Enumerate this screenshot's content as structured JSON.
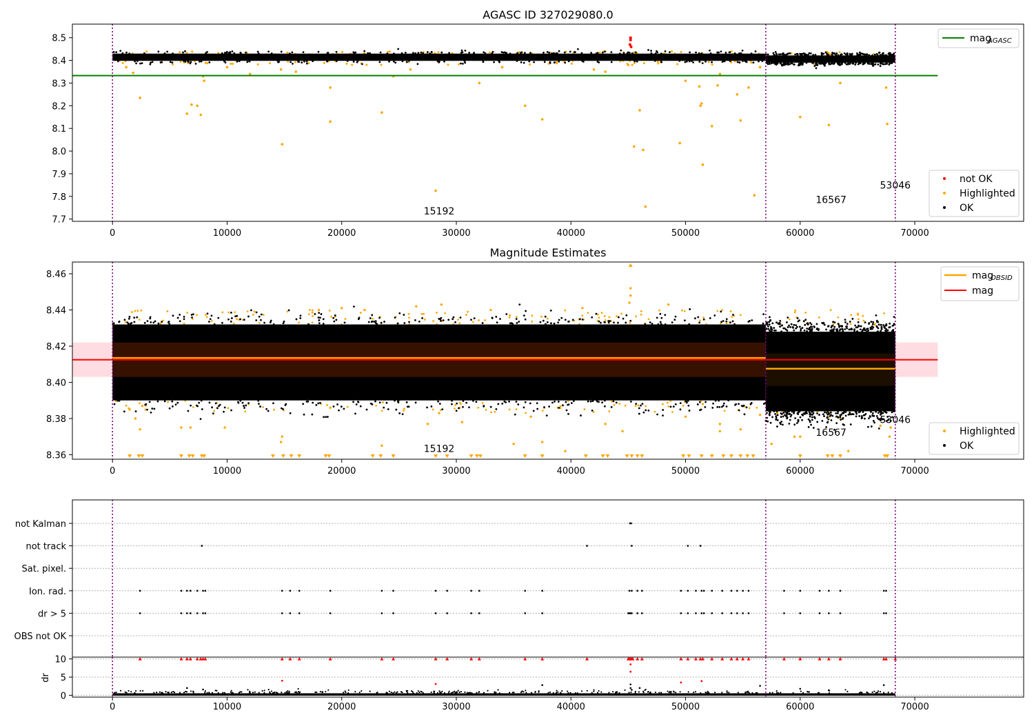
{
  "chart_data": [
    {
      "type": "scatter",
      "title": "AGASC ID 327029080.0",
      "xlim": [
        -3500,
        79500
      ],
      "ylim": [
        7.69,
        8.56
      ],
      "xticks": [
        0,
        10000,
        20000,
        30000,
        40000,
        50000,
        60000,
        70000
      ],
      "yticks": [
        7.7,
        7.8,
        7.9,
        8.0,
        8.1,
        8.2,
        8.3,
        8.4,
        8.5
      ],
      "vlines": [
        0,
        57000,
        68300
      ],
      "legend_position": "upper-right",
      "legend_upper": [
        {
          "label": "mag",
          "subscript": "AGASC",
          "color": "#008000",
          "kind": "line"
        }
      ],
      "legend_lower": [
        {
          "label": "not OK",
          "color": "#ff0000",
          "kind": "dot"
        },
        {
          "label": "Highlighted",
          "color": "#ffa500",
          "kind": "dot"
        },
        {
          "label": "OK",
          "color": "#000000",
          "kind": "dot"
        }
      ],
      "hlines": [
        {
          "name": "mag_AGASC",
          "y": 8.333,
          "x0": -3500,
          "x1": 72000,
          "color": "#008000"
        }
      ],
      "annotations": [
        {
          "text": "15192",
          "x": 28500,
          "y": 7.72
        },
        {
          "text": "16567",
          "x": 62700,
          "y": 7.77
        },
        {
          "text": "53046",
          "x": 68300,
          "y": 7.835
        }
      ],
      "ok_band": {
        "segments": [
          {
            "x0": 0,
            "x1": 57000,
            "ylo": 8.398,
            "yhi": 8.43
          },
          {
            "x0": 57000,
            "x1": 68300,
            "ylo": 8.39,
            "yhi": 8.422
          }
        ]
      },
      "highlighted": [
        [
          1200,
          8.37
        ],
        [
          1800,
          8.345
        ],
        [
          2400,
          8.235
        ],
        [
          6500,
          8.165
        ],
        [
          6900,
          8.205
        ],
        [
          7400,
          8.2
        ],
        [
          7700,
          8.16
        ],
        [
          7900,
          8.33
        ],
        [
          8000,
          8.31
        ],
        [
          14800,
          8.03
        ],
        [
          14700,
          8.36
        ],
        [
          19000,
          8.28
        ],
        [
          19000,
          8.13
        ],
        [
          23500,
          8.17
        ],
        [
          24500,
          8.33
        ],
        [
          28200,
          7.825
        ],
        [
          32000,
          8.3
        ],
        [
          36000,
          8.2
        ],
        [
          37500,
          8.14
        ],
        [
          45000,
          8.38
        ],
        [
          45500,
          8.02
        ],
        [
          46000,
          8.18
        ],
        [
          46300,
          8.005
        ],
        [
          46500,
          7.755
        ],
        [
          49500,
          8.035
        ],
        [
          50000,
          8.31
        ],
        [
          51300,
          8.2
        ],
        [
          51400,
          8.21
        ],
        [
          51500,
          7.94
        ],
        [
          51200,
          8.285
        ],
        [
          52300,
          8.11
        ],
        [
          52800,
          8.29
        ],
        [
          54500,
          8.25
        ],
        [
          54800,
          8.135
        ],
        [
          55500,
          8.28
        ],
        [
          56000,
          7.805
        ],
        [
          56500,
          8.37
        ],
        [
          60000,
          8.15
        ],
        [
          62500,
          8.115
        ],
        [
          63500,
          8.3
        ],
        [
          67500,
          8.28
        ],
        [
          67600,
          8.12
        ],
        [
          12000,
          8.34
        ],
        [
          16000,
          8.35
        ],
        [
          26000,
          8.36
        ],
        [
          43000,
          8.35
        ],
        [
          53000,
          8.34
        ],
        [
          10000,
          8.37
        ],
        [
          34000,
          8.37
        ],
        [
          42000,
          8.36
        ]
      ],
      "not_ok": [
        [
          45200,
          8.5
        ],
        [
          45200,
          8.49
        ],
        [
          45150,
          8.47
        ],
        [
          45250,
          8.46
        ]
      ]
    },
    {
      "type": "scatter",
      "title": "Magnitude Estimates",
      "xlim": [
        -3500,
        79500
      ],
      "ylim": [
        8.3575,
        8.4665
      ],
      "xticks": [
        0,
        10000,
        20000,
        30000,
        40000,
        50000,
        60000,
        70000
      ],
      "yticks": [
        8.36,
        8.38,
        8.4,
        8.42,
        8.44,
        8.46
      ],
      "vlines": [
        0,
        57000,
        68300
      ],
      "legend_position": "upper-right",
      "legend_upper": [
        {
          "label": "mag",
          "subscript": "OBSID",
          "color": "#ffa500",
          "kind": "line"
        },
        {
          "label": "mag",
          "color": "#ff0000",
          "kind": "line"
        }
      ],
      "legend_lower": [
        {
          "label": "Highlighted",
          "color": "#ffa500",
          "kind": "dot"
        },
        {
          "label": "OK",
          "color": "#000000",
          "kind": "dot"
        }
      ],
      "mag": {
        "y": 8.4125,
        "band": [
          8.403,
          8.422
        ],
        "x0": -3500,
        "x1": 72000
      },
      "mag_obsid": [
        {
          "x0": 0,
          "x1": 57000,
          "y": 8.4135
        },
        {
          "x0": 57000,
          "x1": 68300,
          "y": 8.4075
        }
      ],
      "dark_band": [
        {
          "x0": 0,
          "x1": 57000,
          "ylo": 8.403,
          "yhi": 8.422
        },
        {
          "x0": 57000,
          "x1": 68300,
          "ylo": 8.398,
          "yhi": 8.416
        }
      ],
      "ok_band": {
        "segments": [
          {
            "x0": 0,
            "x1": 57000,
            "ylo": 8.39,
            "yhi": 8.432
          },
          {
            "x0": 57000,
            "x1": 68300,
            "ylo": 8.384,
            "yhi": 8.428
          }
        ]
      },
      "annotations": [
        {
          "text": "15192",
          "x": 28500,
          "y": 8.3615
        },
        {
          "text": "16567",
          "x": 62700,
          "y": 8.3705
        },
        {
          "text": "53046",
          "x": 68300,
          "y": 8.3775
        }
      ],
      "highlighted": [
        [
          1500,
          8.385
        ],
        [
          2000,
          8.38
        ],
        [
          2400,
          8.374
        ],
        [
          2600,
          8.387
        ],
        [
          6000,
          8.375
        ],
        [
          6800,
          8.375
        ],
        [
          9800,
          8.375
        ],
        [
          14800,
          8.37
        ],
        [
          14700,
          8.367
        ],
        [
          19000,
          8.386
        ],
        [
          23500,
          8.365
        ],
        [
          27500,
          8.377
        ],
        [
          28500,
          8.383
        ],
        [
          28700,
          8.443
        ],
        [
          30500,
          8.378
        ],
        [
          33000,
          8.44
        ],
        [
          35000,
          8.366
        ],
        [
          36500,
          8.381
        ],
        [
          37500,
          8.367
        ],
        [
          39500,
          8.362
        ],
        [
          43000,
          8.377
        ],
        [
          44500,
          8.373
        ],
        [
          45200,
          8.452
        ],
        [
          45200,
          8.448
        ],
        [
          45100,
          8.444
        ],
        [
          48500,
          8.443
        ],
        [
          50000,
          8.381
        ],
        [
          51500,
          8.388
        ],
        [
          53000,
          8.373
        ],
        [
          53000,
          8.377
        ],
        [
          54800,
          8.374
        ],
        [
          56500,
          8.382
        ],
        [
          57500,
          8.366
        ],
        [
          58000,
          8.383
        ],
        [
          59500,
          8.37
        ],
        [
          60000,
          8.37
        ],
        [
          61500,
          8.384
        ],
        [
          62500,
          8.381
        ],
        [
          63500,
          8.38
        ],
        [
          64200,
          8.362
        ],
        [
          66000,
          8.385
        ],
        [
          67000,
          8.376
        ],
        [
          67800,
          8.37
        ],
        [
          67900,
          8.375
        ],
        [
          66500,
          8.432
        ],
        [
          18000,
          8.44
        ],
        [
          20000,
          8.441
        ],
        [
          22000,
          8.44
        ],
        [
          41000,
          8.441
        ],
        [
          26500,
          8.442
        ]
      ],
      "highlighted_downclipped": [
        1500,
        2300,
        2600,
        6000,
        6700,
        7000,
        7800,
        8000,
        14000,
        14900,
        15600,
        16300,
        18600,
        18900,
        22700,
        23400,
        24500,
        28200,
        29200,
        31300,
        31800,
        32100,
        36000,
        37500,
        41300,
        42800,
        43200,
        44900,
        45300,
        45800,
        46200,
        49800,
        50300,
        51400,
        52300,
        53300,
        54000,
        54800,
        55400,
        55900,
        60000,
        62400,
        62800,
        63500,
        67400,
        67600
      ],
      "highlighted_upclipped": [
        45200
      ]
    },
    {
      "type": "scatter",
      "title": "",
      "xlim": [
        -3500,
        79500
      ],
      "xticks": [
        0,
        10000,
        20000,
        30000,
        40000,
        50000,
        60000,
        70000
      ],
      "vlines": [
        0,
        57000,
        68300
      ],
      "flag_rows": [
        "not Kalman",
        "not track",
        "Sat. pixel.",
        "Ion. rad.",
        "dr > 5",
        "OBS not OK"
      ],
      "flags": {
        "not Kalman": [
          45150,
          45250
        ],
        "not track": [
          7800,
          41400,
          45300,
          50200,
          51300
        ],
        "Sat. pixel.": [],
        "Ion. rad.": [
          2400,
          6000,
          6500,
          6800,
          7400,
          7900,
          8100,
          14800,
          15500,
          16300,
          19000,
          23500,
          24500,
          28200,
          29200,
          31300,
          32000,
          36000,
          37500,
          45100,
          45300,
          45800,
          46200,
          49600,
          50200,
          50900,
          51400,
          51600,
          52300,
          53200,
          54000,
          54500,
          55000,
          55500,
          58600,
          60000,
          61700,
          62500,
          63500,
          67300,
          67500
        ],
        "dr > 5": [
          2400,
          6000,
          6500,
          6800,
          7400,
          7900,
          8100,
          14800,
          15500,
          16300,
          19000,
          23500,
          24500,
          28200,
          29200,
          31300,
          32000,
          36000,
          37500,
          45000,
          45100,
          45200,
          45300,
          45800,
          46200,
          49600,
          50200,
          50900,
          51400,
          51600,
          52300,
          53200,
          54000,
          54500,
          55000,
          55500,
          58600,
          60000,
          61700,
          62500,
          63500,
          67300,
          67500
        ],
        "OBS not OK": []
      }
    },
    {
      "type": "scatter",
      "title": "",
      "ylabel": "dr",
      "xlim": [
        -3500,
        79500
      ],
      "ylim": [
        -0.5,
        10.5
      ],
      "xticks": [
        0,
        10000,
        20000,
        30000,
        40000,
        50000,
        60000,
        70000
      ],
      "xtick_labels": [
        "0",
        "10000",
        "20000",
        "30000",
        "40000",
        "50000",
        "60000",
        "70000"
      ],
      "yticks": [
        0,
        5,
        10
      ],
      "vlines": [
        0,
        57000,
        68300
      ],
      "clipped_red_triangles": [
        2400,
        6000,
        6500,
        6800,
        7400,
        7700,
        7900,
        8100,
        14800,
        15500,
        16300,
        19000,
        23500,
        24500,
        28200,
        29200,
        31300,
        32000,
        36000,
        37500,
        41400,
        45000,
        45100,
        45200,
        45300,
        45400,
        45800,
        46200,
        49600,
        50200,
        50900,
        51300,
        51500,
        52300,
        53200,
        54000,
        54500,
        55000,
        55500,
        58600,
        60000,
        61700,
        62500,
        63500,
        67300,
        67500,
        68300
      ],
      "red_points": [
        [
          14800,
          4.0
        ],
        [
          28200,
          3.1
        ],
        [
          45200,
          8.5
        ],
        [
          45200,
          6.5
        ],
        [
          49600,
          3.5
        ],
        [
          51400,
          3.9
        ]
      ],
      "dark_points": [
        [
          6500,
          2.0
        ],
        [
          7900,
          1.6
        ],
        [
          37500,
          2.8
        ],
        [
          45200,
          3.0
        ],
        [
          45200,
          2.0
        ],
        [
          45300,
          1.5
        ],
        [
          46000,
          2.0
        ],
        [
          56500,
          2.6
        ],
        [
          60000,
          1.8
        ],
        [
          62500,
          1.4
        ],
        [
          67300,
          2.8
        ]
      ]
    }
  ]
}
